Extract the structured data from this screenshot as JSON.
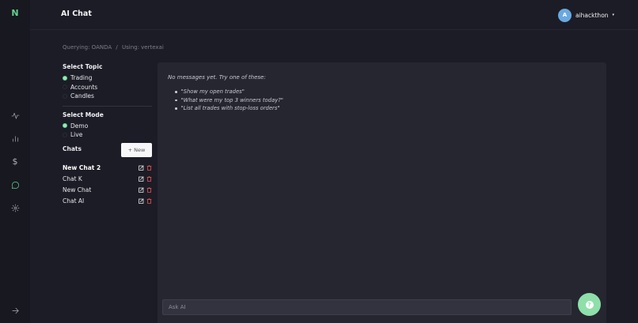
{
  "app": {
    "logo": "N",
    "title": "AI Chat"
  },
  "user": {
    "initial": "A",
    "name": "aihackthon",
    "caret": "▾"
  },
  "nav": {
    "dollar": "$",
    "icons": [
      "activity-icon",
      "bar-chart-icon",
      "dollar-icon",
      "chat-icon",
      "gear-icon",
      "arrow-right-icon"
    ]
  },
  "breadcrumb": {
    "query": "Querying: OANDA",
    "sep": "/",
    "using": "Using: vertexai"
  },
  "topic": {
    "title": "Select Topic",
    "options": [
      "Trading",
      "Accounts",
      "Candles"
    ],
    "selected": "Trading"
  },
  "mode": {
    "title": "Select Mode",
    "options": [
      "Demo",
      "Live"
    ],
    "selected": "Demo"
  },
  "chats": {
    "title": "Chats",
    "new_label": "+ New",
    "items": [
      {
        "name": "New Chat 2",
        "active": true
      },
      {
        "name": "Chat K",
        "active": false
      },
      {
        "name": "New Chat",
        "active": false
      },
      {
        "name": "Chat AI",
        "active": false
      }
    ]
  },
  "conversation": {
    "empty_note": "No messages yet. Try one of these:",
    "suggestions": [
      "\"Show my open trades\"",
      "\"What were my top 3 winners today?\"",
      "\"List all trades with stop-loss orders\""
    ]
  },
  "composer": {
    "placeholder": "Ask AI",
    "value": ""
  },
  "help": {
    "glyph": "?"
  },
  "colors": {
    "accent": "#5fd38f",
    "fab": "#8edfa9",
    "danger": "#d9534f",
    "avatar": "#6aa9df",
    "background": "#1c1c26",
    "panel": "#262630"
  }
}
